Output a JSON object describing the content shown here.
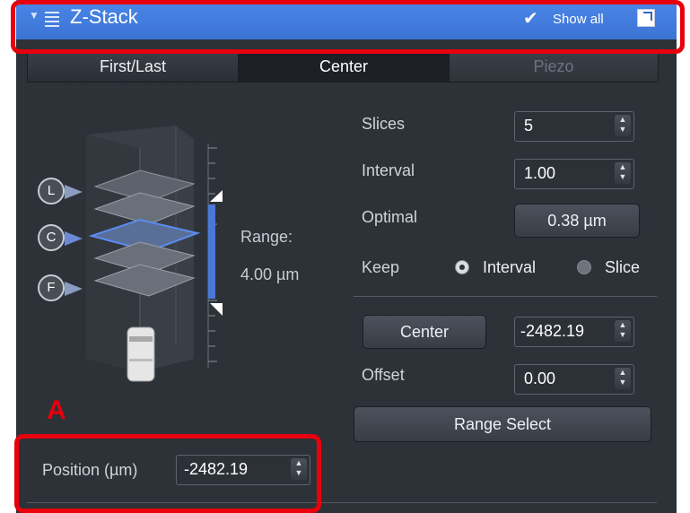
{
  "titlebar": {
    "title": "Z-Stack",
    "show_all": "Show all"
  },
  "tabs": [
    {
      "label": "First/Last"
    },
    {
      "label": "Center"
    },
    {
      "label": "Piezo"
    }
  ],
  "diagram": {
    "markers": [
      "L",
      "C",
      "F"
    ],
    "range_label": "Range:",
    "range_value": "4.00 µm"
  },
  "fields": {
    "slices_label": "Slices",
    "slices_value": "5",
    "interval_label": "Interval",
    "interval_value": "1.00",
    "optimal_label": "Optimal",
    "optimal_value": "0.38 µm",
    "keep_label": "Keep",
    "keep_interval": "Interval",
    "keep_slice": "Slice",
    "center_button": "Center",
    "center_value": "-2482.19",
    "offset_label": "Offset",
    "offset_value": "0.00",
    "range_select": "Range Select",
    "position_label": "Position (µm)",
    "position_value": "-2482.19"
  },
  "annotation": {
    "letter": "A"
  },
  "colors": {
    "accent": "#4a86e8",
    "annotation": "#e8000c",
    "panel": "#2d3138"
  }
}
